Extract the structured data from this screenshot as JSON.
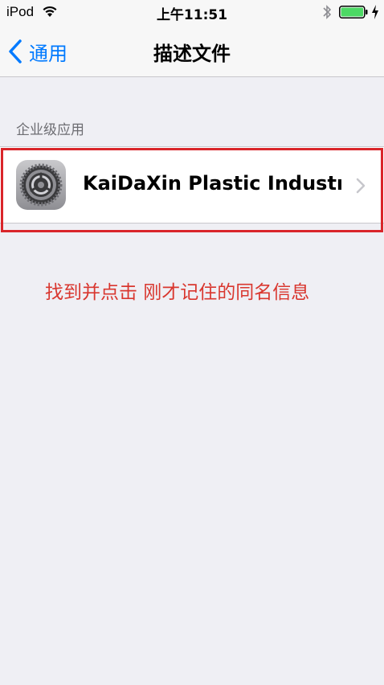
{
  "status_bar": {
    "carrier": "iPod",
    "time": "上午11:51",
    "battery_color": "#4cd964"
  },
  "nav_bar": {
    "back_label": "通用",
    "title": "描述文件",
    "accent_color": "#007aff"
  },
  "section": {
    "header": "企业级应用"
  },
  "profile_row": {
    "icon": "settings-gear-icon",
    "label": "KaiDaXin Plastic Industry..."
  },
  "annotation": {
    "instruction": "找到并点击 刚才记住的同名信息",
    "color": "#d9252a"
  }
}
